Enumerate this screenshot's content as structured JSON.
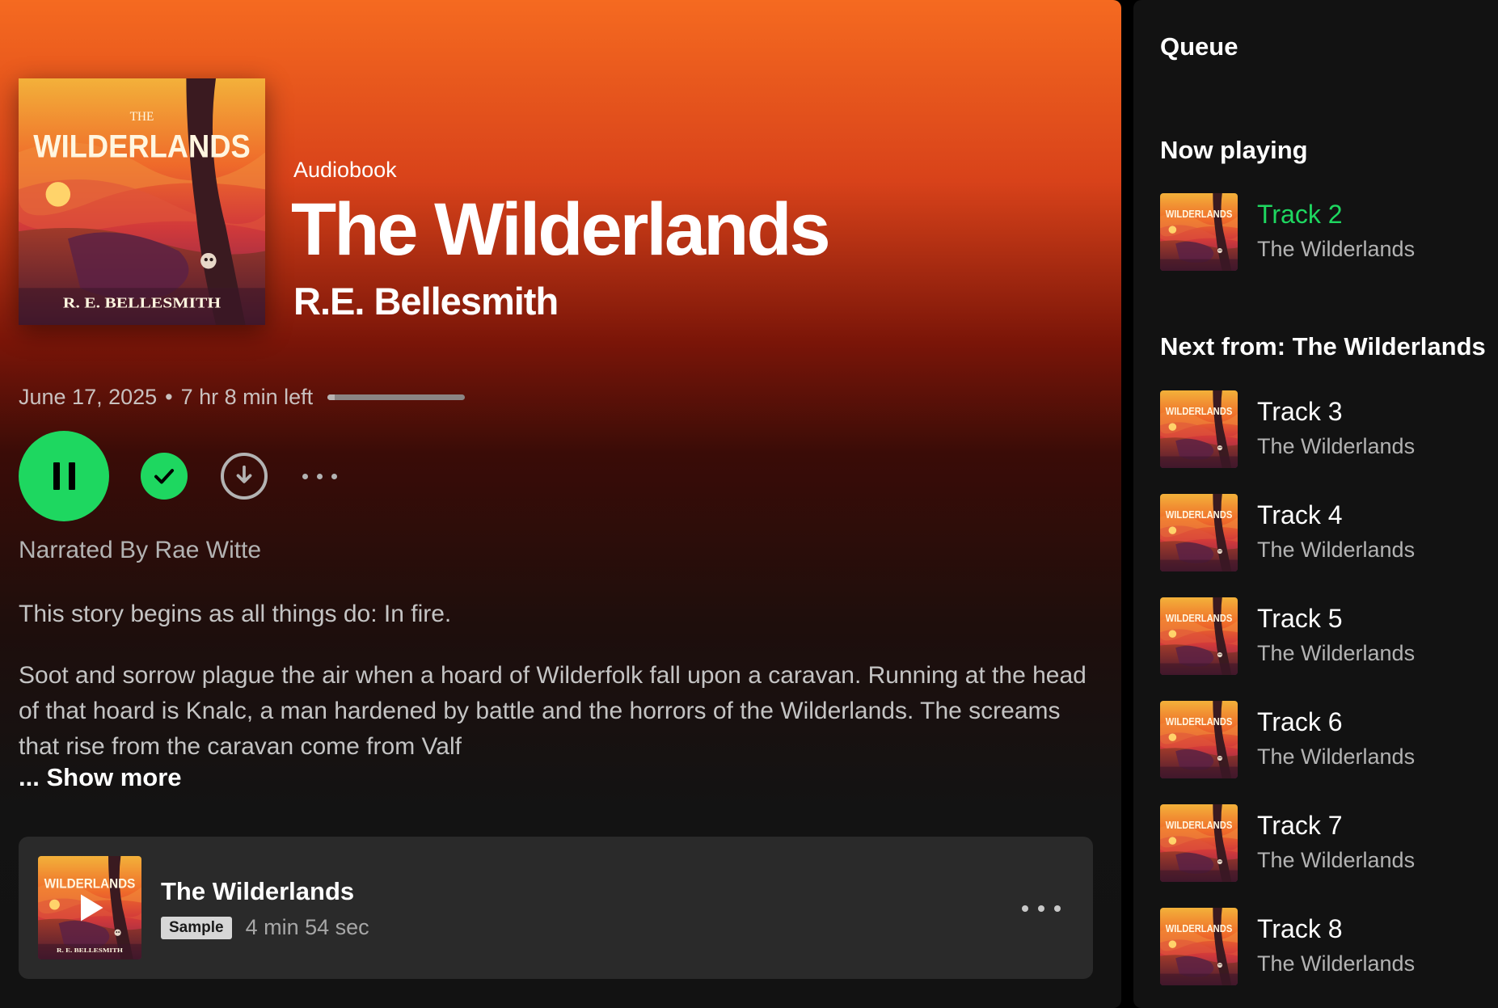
{
  "audiobook": {
    "type_label": "Audiobook",
    "title": "The Wilderlands",
    "author": "R.E. Bellesmith",
    "release_date": "June 17, 2025",
    "separator": "•",
    "time_left": "7 hr 8 min left",
    "progress_fraction": 0.05,
    "narrated_by": "Narrated By Rae Witte",
    "description_p1": "This story begins as all things do: In fire.",
    "description_p2": "Soot and sorrow plague the air when a hoard of Wilderfolk fall upon a caravan. Running at the head of that hoard is Knalc, a man hardened by battle and the horrors of the Wilderlands. The screams that rise from the caravan come from Valf",
    "show_more": "... Show more"
  },
  "cover_art": {
    "top_text": "THE",
    "main_text": "WILDERLANDS",
    "author_text": "R. E. BELLESMITH"
  },
  "controls": {
    "play_state": "playing",
    "icons": [
      "pause-icon",
      "check-icon",
      "download-icon",
      "more-icon"
    ]
  },
  "sample": {
    "title": "The Wilderlands",
    "badge": "Sample",
    "duration": "4 min 54 sec"
  },
  "queue": {
    "title": "Queue",
    "now_playing_heading": "Now playing",
    "next_heading": "Next from: The Wilderlands",
    "now_playing": {
      "name": "Track 2",
      "subtitle": "The Wilderlands"
    },
    "next": [
      {
        "name": "Track 3",
        "subtitle": "The Wilderlands"
      },
      {
        "name": "Track 4",
        "subtitle": "The Wilderlands"
      },
      {
        "name": "Track 5",
        "subtitle": "The Wilderlands"
      },
      {
        "name": "Track 6",
        "subtitle": "The Wilderlands"
      },
      {
        "name": "Track 7",
        "subtitle": "The Wilderlands"
      },
      {
        "name": "Track 8",
        "subtitle": "The Wilderlands"
      }
    ]
  },
  "colors": {
    "accent_green": "#1ed760",
    "gradient_top": "#f56a20",
    "panel_bg": "#121212",
    "card_bg": "#2a2a2a"
  }
}
